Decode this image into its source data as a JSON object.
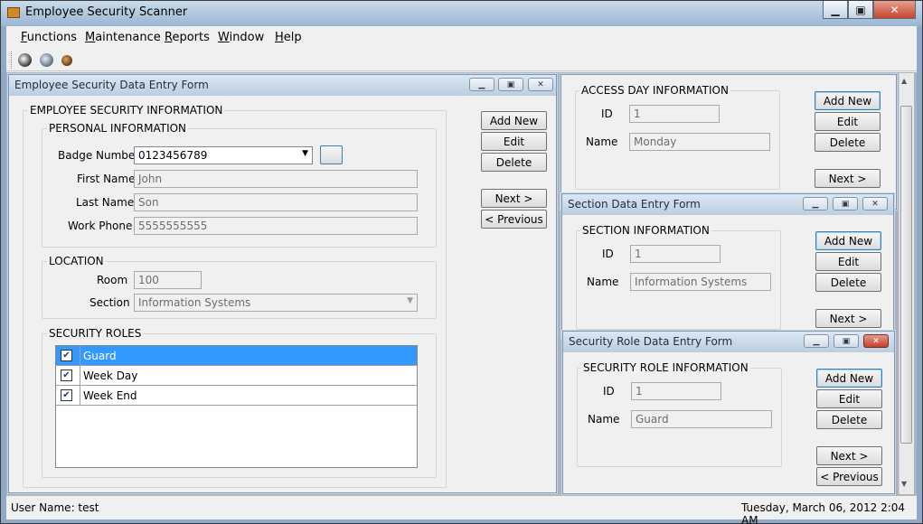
{
  "app": {
    "title": "Employee Security Scanner"
  },
  "window_controls": {
    "minimize": "▁",
    "maximize": "▣",
    "close": "✕"
  },
  "menu": [
    "Functions",
    "Maintenance",
    "Reports",
    "Window",
    "Help"
  ],
  "toolbar": {
    "icons": [
      "scanner-icon",
      "globe-icon",
      "shield-icon"
    ]
  },
  "employee_form": {
    "title": "Employee Security Data Entry Form",
    "group_title": "EMPLOYEE SECURITY INFORMATION",
    "personal": {
      "title": "PERSONAL INFORMATION",
      "badge_label": "Badge Number",
      "badge_value": "0123456789",
      "first_label": "First Name",
      "first_value": "John",
      "last_label": "Last Name",
      "last_value": "Son",
      "phone_label": "Work Phone",
      "phone_value": "5555555555"
    },
    "location": {
      "title": "LOCATION",
      "room_label": "Room",
      "room_value": "100",
      "section_label": "Section",
      "section_value": "Information Systems"
    },
    "roles": {
      "title": "SECURITY ROLES",
      "items": [
        {
          "label": "Guard",
          "checked": true,
          "selected": true
        },
        {
          "label": "Week Day",
          "checked": true
        },
        {
          "label": "Week End",
          "checked": true
        }
      ]
    },
    "buttons": {
      "add_new": "Add New",
      "edit": "Edit",
      "delete": "Delete",
      "next": "Next >",
      "previous": "< Previous"
    }
  },
  "access_day_form": {
    "group_title": "ACCESS DAY INFORMATION",
    "id_label": "ID",
    "id_value": "1",
    "name_label": "Name",
    "name_value": "Monday",
    "buttons": {
      "add_new": "Add New",
      "edit": "Edit",
      "delete": "Delete",
      "next": "Next >"
    }
  },
  "section_form": {
    "title": "Section Data Entry Form",
    "group_title": "SECTION INFORMATION",
    "id_label": "ID",
    "id_value": "1",
    "name_label": "Name",
    "name_value": "Information Systems",
    "buttons": {
      "add_new": "Add New",
      "edit": "Edit",
      "delete": "Delete",
      "next": "Next >"
    }
  },
  "role_form": {
    "title": "Security Role Data Entry Form",
    "group_title": "SECURITY ROLE INFORMATION",
    "id_label": "ID",
    "id_value": "1",
    "name_label": "Name",
    "name_value": "Guard",
    "buttons": {
      "add_new": "Add New",
      "edit": "Edit",
      "delete": "Delete",
      "next": "Next >",
      "previous": "< Previous"
    }
  },
  "status": {
    "user": "User Name: test",
    "datetime": "Tuesday, March 06, 2012 2:04 AM"
  },
  "colors": {
    "accent": "#3399ff",
    "titlebar": "#bccde0",
    "close_red": "#c2412d"
  }
}
